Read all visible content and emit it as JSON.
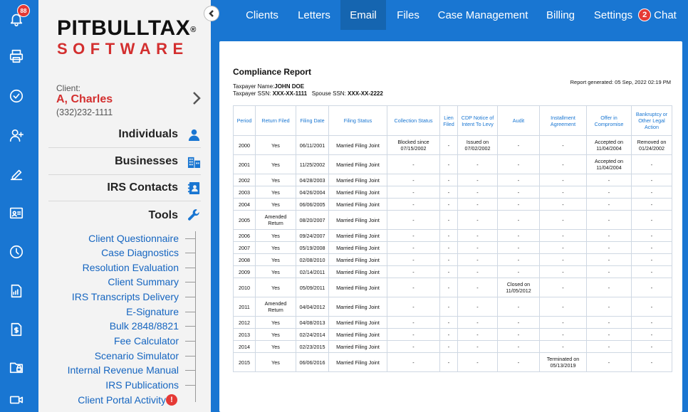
{
  "notifications": {
    "count": "88"
  },
  "rail_icons": [
    "bell-icon",
    "printer-icon",
    "check-circle-icon",
    "add-user-icon",
    "edit-icon",
    "id-card-icon",
    "clock-icon",
    "report-icon",
    "invoice-icon",
    "lock-folder-icon",
    "video-icon"
  ],
  "logo": {
    "top": "PITBULLTAX",
    "reg": "®",
    "bottom": "SOFTWARE"
  },
  "client": {
    "label": "Client:",
    "name": "A, Charles",
    "phone": "(332)232-1111"
  },
  "sections": {
    "individuals": "Individuals",
    "businesses": "Businesses",
    "irs_contacts": "IRS Contacts",
    "tools": "Tools"
  },
  "tools": [
    "Client Questionnaire",
    "Case Diagnostics",
    "Resolution Evaluation",
    "Client Summary",
    "IRS Transcripts Delivery",
    "E-Signature",
    "Bulk 2848/8821",
    "Fee Calculator",
    "Scenario Simulator",
    "Internal Revenue Manual",
    "IRS Publications",
    "Client Portal Activity"
  ],
  "tools_alert": "!",
  "nav": {
    "tabs": [
      "Clients",
      "Letters",
      "Email",
      "Files",
      "Case Management",
      "Billing",
      "Settings"
    ],
    "active": "Email",
    "chat_label": "Chat",
    "chat_count": "2"
  },
  "report": {
    "title": "Compliance Report",
    "taxpayer_name_label": "Taxpayer Name:",
    "taxpayer_name": "JOHN DOE",
    "taxpayer_ssn_label": "Taxpayer SSN:",
    "taxpayer_ssn": "XXX-XX-1111",
    "spouse_ssn_label": "Spouse SSN:",
    "spouse_ssn": "XXX-XX-2222",
    "generated": "Report generated: 05 Sep, 2022 02:19 PM",
    "columns": [
      "Period",
      "Return Filed",
      "Filing Date",
      "Filing Status",
      "Collection Status",
      "Lien Filed",
      "CDP Notice of Intent To Levy",
      "Audit",
      "Installment Agreement",
      "Offer in Compromise",
      "Bankruptcy or Other Legal Action"
    ],
    "rows": [
      [
        "2000",
        "Yes",
        "06/11/2001",
        "Married Filing Joint",
        "Blocked since 07/15/2002",
        "-",
        "Issued on 07/02/2002",
        "-",
        "-",
        "Accepted on 11/04/2004",
        "Removed on 01/24/2002"
      ],
      [
        "2001",
        "Yes",
        "11/25/2002",
        "Married Filing Joint",
        "-",
        "-",
        "-",
        "-",
        "-",
        "Accepted on 11/04/2004",
        "-"
      ],
      [
        "2002",
        "Yes",
        "04/28/2003",
        "Married Filing Joint",
        "-",
        "-",
        "-",
        "-",
        "-",
        "-",
        "-"
      ],
      [
        "2003",
        "Yes",
        "04/26/2004",
        "Married Filing Joint",
        "-",
        "-",
        "-",
        "-",
        "-",
        "-",
        "-"
      ],
      [
        "2004",
        "Yes",
        "06/06/2005",
        "Married Filing Joint",
        "-",
        "-",
        "-",
        "-",
        "-",
        "-",
        "-"
      ],
      [
        "2005",
        "Amended Return",
        "08/20/2007",
        "Married Filing Joint",
        "-",
        "-",
        "-",
        "-",
        "-",
        "-",
        "-"
      ],
      [
        "2006",
        "Yes",
        "09/24/2007",
        "Married Filing Joint",
        "-",
        "-",
        "-",
        "-",
        "-",
        "-",
        "-"
      ],
      [
        "2007",
        "Yes",
        "05/19/2008",
        "Married Filing Joint",
        "-",
        "-",
        "-",
        "-",
        "-",
        "-",
        "-"
      ],
      [
        "2008",
        "Yes",
        "02/08/2010",
        "Married Filing Joint",
        "-",
        "-",
        "-",
        "-",
        "-",
        "-",
        "-"
      ],
      [
        "2009",
        "Yes",
        "02/14/2011",
        "Married Filing Joint",
        "-",
        "-",
        "-",
        "-",
        "-",
        "-",
        "-"
      ],
      [
        "2010",
        "Yes",
        "05/09/2011",
        "Married Filing Joint",
        "-",
        "-",
        "-",
        "Closed on 11/05/2012",
        "-",
        "-",
        "-"
      ],
      [
        "2011",
        "Amended Return",
        "04/04/2012",
        "Married Filing Joint",
        "-",
        "-",
        "-",
        "-",
        "-",
        "-",
        "-"
      ],
      [
        "2012",
        "Yes",
        "04/08/2013",
        "Married Filing Joint",
        "-",
        "-",
        "-",
        "-",
        "-",
        "-",
        "-"
      ],
      [
        "2013",
        "Yes",
        "02/24/2014",
        "Married Filing Joint",
        "-",
        "-",
        "-",
        "-",
        "-",
        "-",
        "-"
      ],
      [
        "2014",
        "Yes",
        "02/23/2015",
        "Married Filing Joint",
        "-",
        "-",
        "-",
        "-",
        "-",
        "-",
        "-"
      ],
      [
        "2015",
        "Yes",
        "06/06/2016",
        "Married Filing Joint",
        "-",
        "-",
        "-",
        "-",
        "Terminated on 05/13/2019",
        "-",
        "-"
      ]
    ]
  },
  "colors": {
    "brand_blue": "#1976d2",
    "brand_red": "#d32f2f",
    "alert_red": "#e53935"
  }
}
